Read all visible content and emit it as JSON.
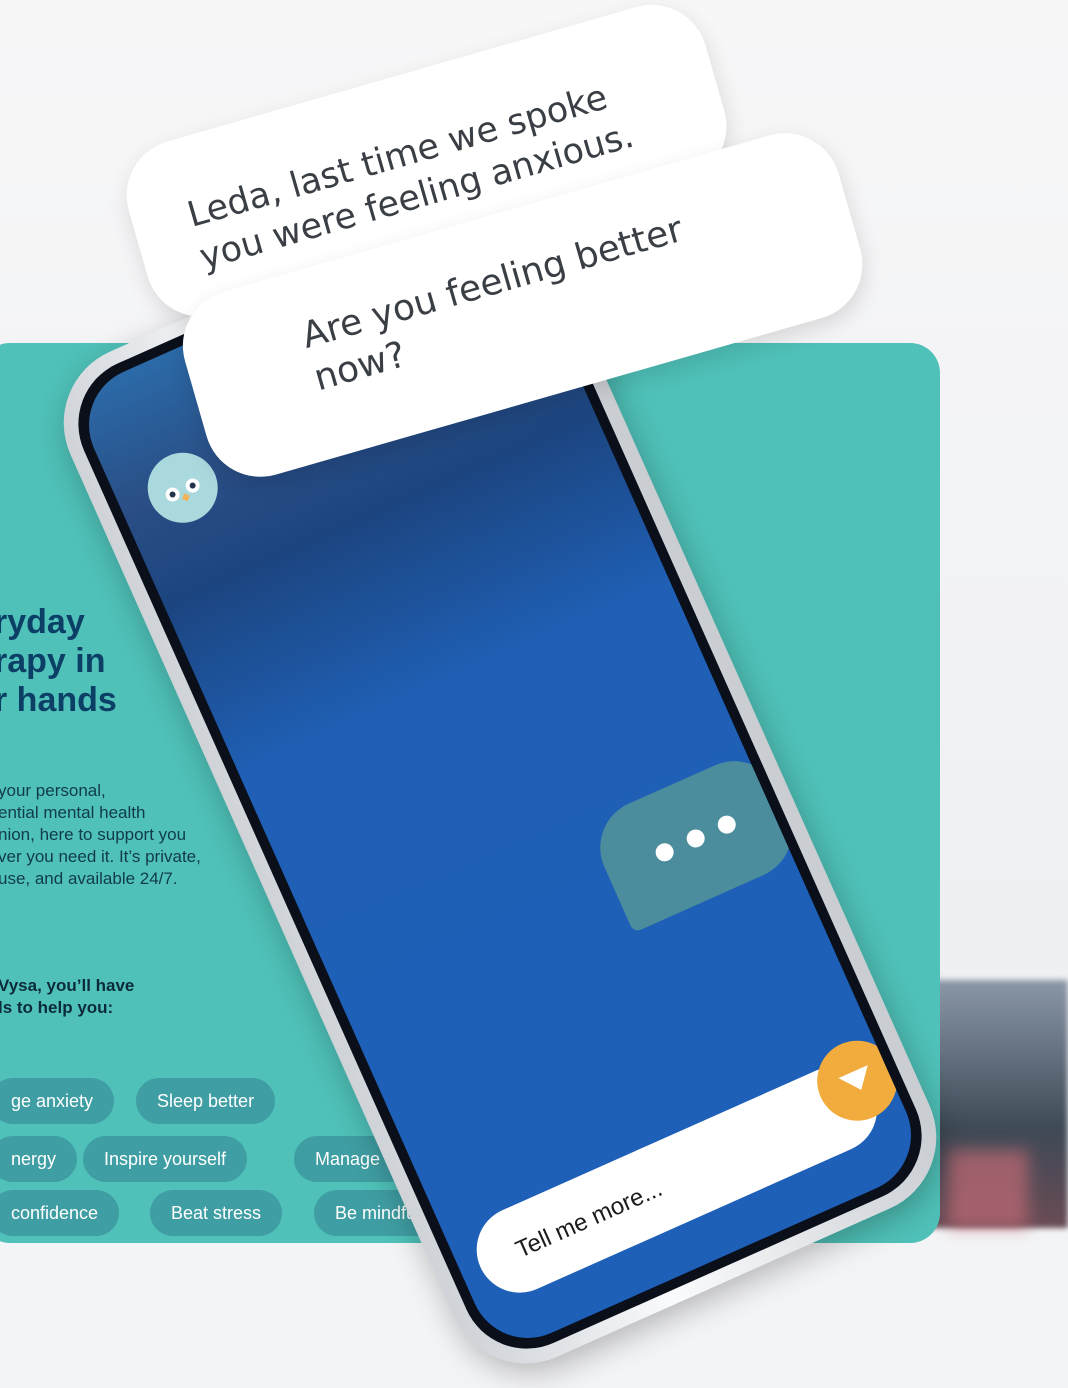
{
  "promo": {
    "headline": "ryday\nrapy in\nr hands",
    "description": "your personal,\nential mental health\nnion, here to support you\nver you need it. It’s private,\nuse, and available 24/7.",
    "tools_intro": "Vysa, you’ll have\nls to help you:",
    "chips": [
      "ge anxiety",
      "Sleep better",
      "nergy",
      "Inspire yourself",
      "Manage anger",
      "confidence",
      "Beat stress",
      "Be mindful"
    ]
  },
  "phone": {
    "messages": [
      "Leda, last time we spoke\nyou were feeling anxious.",
      "Are you feeling better\nnow?"
    ],
    "input_placeholder": "Tell me more...",
    "icons": {
      "avatar": "owl-avatar-icon",
      "send": "send-icon",
      "typing": "typing-indicator-icon"
    }
  },
  "colors": {
    "teal_card": "#4fc1b8",
    "chip": "#3f9ea3",
    "headline": "#0c3f66",
    "send_button": "#f2ac3d",
    "screen_blue": "#1e5fb8"
  }
}
